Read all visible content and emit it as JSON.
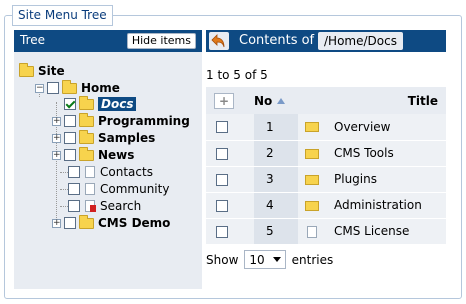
{
  "fieldset": {
    "legend": "Site Menu Tree"
  },
  "tree": {
    "title": "Tree",
    "hide_label": "Hide items",
    "root": "Site",
    "home": "Home",
    "items": [
      {
        "label": "Docs"
      },
      {
        "label": "Programming"
      },
      {
        "label": "Samples"
      },
      {
        "label": "News"
      },
      {
        "label": "Contacts"
      },
      {
        "label": "Community"
      },
      {
        "label": "Search"
      },
      {
        "label": "CMS Demo"
      }
    ]
  },
  "content": {
    "contents_of": "Contents of",
    "path": "/Home/Docs",
    "info": "1 to 5 of 5",
    "columns": {
      "add": "+",
      "no": "No",
      "title": "Title"
    },
    "rows": [
      {
        "no": "1",
        "title": "Overview",
        "icon": "folder-icon"
      },
      {
        "no": "2",
        "title": "CMS Tools",
        "icon": "folder-icon"
      },
      {
        "no": "3",
        "title": "Plugins",
        "icon": "folder-icon"
      },
      {
        "no": "4",
        "title": "Administration",
        "icon": "folder-icon"
      },
      {
        "no": "5",
        "title": "CMS License",
        "icon": "document-icon"
      }
    ],
    "show_label": "Show",
    "page_size": "10",
    "entries_label": "entries"
  },
  "colors": {
    "header_bg": "#0e4a83",
    "panel_bg": "#e8ecf2"
  }
}
